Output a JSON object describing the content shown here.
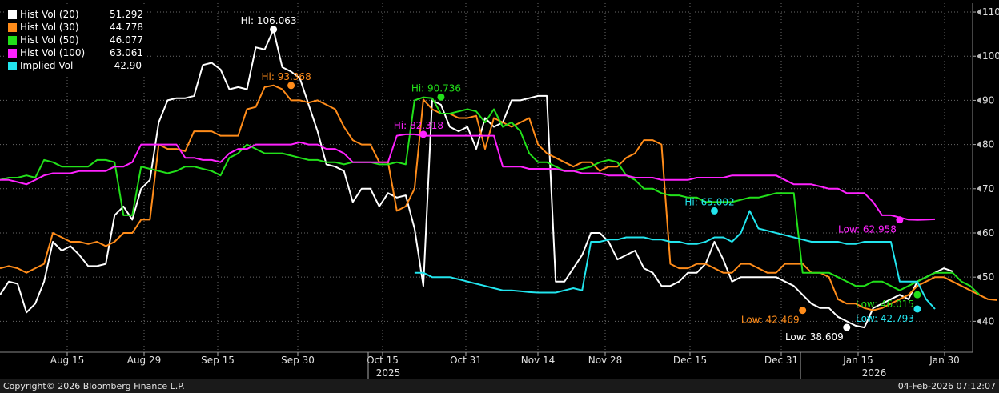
{
  "legend": [
    {
      "name": "Hist Vol (20)",
      "value": "51.292",
      "color": "#ffffff"
    },
    {
      "name": "Hist Vol (30)",
      "value": "44.778",
      "color": "#ff8c1a"
    },
    {
      "name": "Hist Vol (50)",
      "value": "46.077",
      "color": "#22e01a"
    },
    {
      "name": "Hist Vol (100)",
      "value": "63.061",
      "color": "#ff22ff"
    },
    {
      "name": "Implied Vol",
      "value": "42.90",
      "color": "#22e5ee"
    }
  ],
  "footer": {
    "copyright": "Copyright© 2026 Bloomberg Finance L.P.",
    "timestamp": "04-Feb-2026 07:12:07"
  },
  "chart_data": {
    "type": "line",
    "x_axis": {
      "ticks": [
        "Aug 15",
        "Aug 29",
        "Sep 15",
        "Sep 30",
        "Oct 15",
        "Oct 31",
        "Nov 14",
        "Nov 28",
        "Dec 15",
        "Dec 31",
        "Jan 15",
        "Jan 30"
      ],
      "years": [
        "2025",
        "2026"
      ]
    },
    "y_axis": {
      "side": "right",
      "ticks": [
        40,
        50,
        60,
        70,
        80,
        90,
        100,
        110
      ],
      "ylim": [
        33,
        112
      ]
    },
    "grid": true,
    "legend_position": "top-left",
    "series": [
      {
        "name": "Hist Vol (20)",
        "color": "#ffffff",
        "values": [
          46,
          49,
          48.5,
          42,
          44,
          49,
          58,
          56,
          57,
          55,
          52.5,
          52.5,
          53,
          64,
          66,
          63,
          70,
          72,
          85,
          90,
          90.5,
          90.5,
          91,
          98,
          98.5,
          97,
          92.5,
          93,
          92.5,
          102,
          101.5,
          106,
          97.5,
          96.5,
          95,
          89,
          83,
          75.5,
          75,
          74,
          67,
          70,
          70,
          66,
          69,
          68,
          68.5,
          61,
          48,
          90,
          89,
          84,
          83,
          84,
          79,
          86,
          84,
          85,
          90,
          90,
          90.5,
          91,
          91,
          49,
          49,
          52,
          55,
          60,
          60,
          58,
          54,
          55,
          56,
          52,
          51,
          48,
          48,
          49,
          51,
          51,
          53,
          58,
          54,
          49,
          50,
          50,
          50,
          50,
          50,
          49,
          48,
          46,
          44,
          43,
          43,
          41,
          40,
          39,
          38.6,
          43,
          44,
          45,
          46,
          45,
          49,
          50,
          51,
          52,
          51.3
        ]
      },
      {
        "name": "Hist Vol (30)",
        "color": "#ff8c1a",
        "values": [
          52,
          52.5,
          52,
          51,
          52,
          53,
          60,
          59,
          58,
          58,
          57.5,
          58,
          57,
          58,
          60,
          60,
          63,
          63,
          80,
          79,
          79,
          78.5,
          83,
          83,
          83,
          82,
          82,
          82,
          88,
          88.5,
          93,
          93.4,
          92.5,
          90,
          90,
          89.5,
          90,
          89,
          88,
          84,
          81,
          80,
          80,
          76,
          76,
          65,
          66,
          70,
          90.2,
          88,
          87,
          87,
          86,
          86,
          86.5,
          79,
          86,
          85,
          84,
          85,
          86,
          80,
          78,
          77,
          76,
          75,
          76,
          76,
          74,
          75,
          75,
          77,
          78,
          81,
          81,
          80,
          53,
          52,
          52,
          53,
          53,
          52,
          51,
          51,
          53,
          53,
          52,
          51,
          51,
          53,
          53,
          53,
          51,
          51,
          50,
          45,
          44,
          44,
          43,
          42.5,
          43,
          44,
          45,
          46,
          48,
          49,
          50,
          50,
          49,
          48,
          47,
          46,
          45,
          44.8
        ]
      },
      {
        "name": "Hist Vol (50)",
        "color": "#22e01a",
        "values": [
          72,
          72.5,
          72.5,
          73,
          72.5,
          76.5,
          76,
          75,
          75,
          75,
          75,
          76.5,
          76.5,
          76,
          64,
          64,
          75,
          74.5,
          74,
          73.5,
          74,
          75,
          75,
          74.5,
          74,
          73,
          77,
          78,
          80,
          79,
          78,
          78,
          78,
          77.5,
          77,
          76.5,
          76.5,
          76,
          76,
          75.5,
          76,
          76,
          76,
          75.5,
          75.5,
          76,
          75.5,
          90,
          90.7,
          90.5,
          87,
          87,
          87.5,
          88,
          87.5,
          85,
          88,
          84,
          85,
          83,
          78,
          76,
          76,
          75,
          74,
          74,
          74.5,
          75,
          76,
          76.5,
          76,
          73,
          72,
          70,
          70,
          69,
          68.5,
          68.5,
          68,
          68,
          67,
          67,
          67,
          67,
          67.5,
          68,
          68,
          68.5,
          69,
          69,
          69,
          51,
          51,
          51,
          51,
          50,
          49,
          48,
          48,
          49,
          49,
          48,
          47,
          48,
          49,
          50,
          51,
          51,
          51,
          49,
          48,
          46.1
        ]
      },
      {
        "name": "Hist Vol (100)",
        "color": "#ff22ff",
        "values": [
          72,
          72,
          71.5,
          71,
          72,
          73,
          73.5,
          73.5,
          73.5,
          74,
          74,
          74,
          74,
          75,
          75,
          76,
          80,
          80,
          80,
          80,
          80,
          77,
          77,
          76.5,
          76.5,
          76,
          78,
          79,
          79,
          80,
          80,
          80,
          80,
          80,
          80.5,
          80,
          80,
          79,
          79,
          78,
          76,
          76,
          76,
          76,
          76,
          82,
          82.3,
          82.3,
          82,
          82,
          82,
          82,
          82,
          82,
          82,
          82,
          82,
          75,
          75,
          75,
          74.5,
          74.5,
          74.5,
          74.5,
          74,
          74,
          73.5,
          73.5,
          73.5,
          73,
          73,
          73,
          72.5,
          72.5,
          72.5,
          72,
          72,
          72,
          72,
          72.5,
          72.5,
          72.5,
          72.5,
          73,
          73,
          73,
          73,
          73,
          73,
          72,
          71,
          71,
          71,
          70.5,
          70,
          70,
          69,
          69,
          69,
          67,
          64,
          64,
          63.5,
          63,
          62.96,
          63,
          63.1
        ]
      },
      {
        "name": "Implied Vol",
        "color": "#22e5ee",
        "values": [
          null,
          null,
          null,
          null,
          null,
          null,
          null,
          null,
          null,
          null,
          null,
          null,
          null,
          null,
          null,
          null,
          null,
          null,
          null,
          null,
          null,
          null,
          null,
          null,
          null,
          null,
          null,
          null,
          null,
          null,
          null,
          null,
          null,
          null,
          null,
          null,
          null,
          null,
          null,
          null,
          null,
          null,
          null,
          null,
          null,
          null,
          null,
          51,
          51,
          50,
          50,
          50,
          49.5,
          49,
          48.5,
          48,
          47.5,
          47,
          47,
          46.8,
          46.6,
          46.5,
          46.5,
          46.5,
          47,
          47.5,
          47,
          58,
          58,
          58.5,
          58.5,
          59,
          59,
          59,
          58.5,
          58.5,
          58,
          58,
          57.5,
          57.5,
          58,
          59,
          59,
          58,
          60,
          65,
          61,
          60.5,
          60,
          59.5,
          59,
          58.5,
          58,
          58,
          58,
          58,
          57.5,
          57.5,
          58,
          58,
          58,
          58,
          49,
          49,
          49,
          45,
          42.79
        ]
      }
    ],
    "markers": [
      {
        "series": "Hist Vol (20)",
        "label": "Hi: 106.063",
        "value": 106.063,
        "index": 31
      },
      {
        "series": "Hist Vol (20)",
        "label": "Low: 38.609",
        "value": 38.609,
        "index": 96
      },
      {
        "series": "Hist Vol (30)",
        "label": "Hi: 93.368",
        "value": 93.368,
        "index": 33
      },
      {
        "series": "Hist Vol (30)",
        "label": "Low: 42.469",
        "value": 42.469,
        "index": 91
      },
      {
        "series": "Hist Vol (50)",
        "label": "Hi: 90.736",
        "value": 90.736,
        "index": 50
      },
      {
        "series": "Hist Vol (50)",
        "label": "Low: 46.015",
        "value": 46.015,
        "index": 104
      },
      {
        "series": "Hist Vol (100)",
        "label": "Hi: 82.318",
        "value": 82.318,
        "index": 48
      },
      {
        "series": "Hist Vol (100)",
        "label": "Low: 62.958",
        "value": 62.958,
        "index": 102
      },
      {
        "series": "Implied Vol",
        "label": "Hi: 65.002",
        "value": 65.002,
        "index": 81
      },
      {
        "series": "Implied Vol",
        "label": "Low: 42.793",
        "value": 42.793,
        "index": 104
      }
    ]
  }
}
